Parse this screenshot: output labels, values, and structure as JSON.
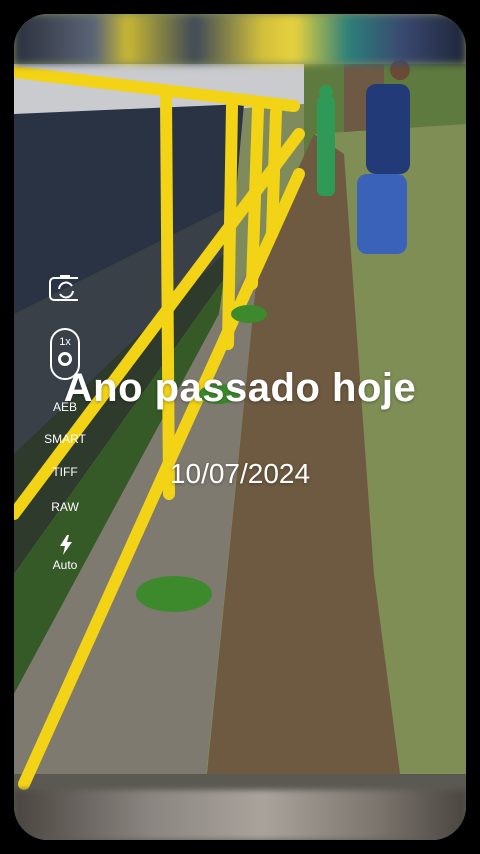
{
  "memory": {
    "title": "Ano passado hoje",
    "date": "10/07/2024"
  },
  "camera_controls": {
    "zoom_label": "1x",
    "aeb_label": "AEB",
    "smart_label": "SMART",
    "tiff_label": "TIFF",
    "raw_label": "RAW",
    "flash_label": "Auto",
    "icons": [
      "camera-switch-icon",
      "flash-icon"
    ]
  },
  "colors": {
    "rail": "#f2d316",
    "background": "#000000"
  }
}
